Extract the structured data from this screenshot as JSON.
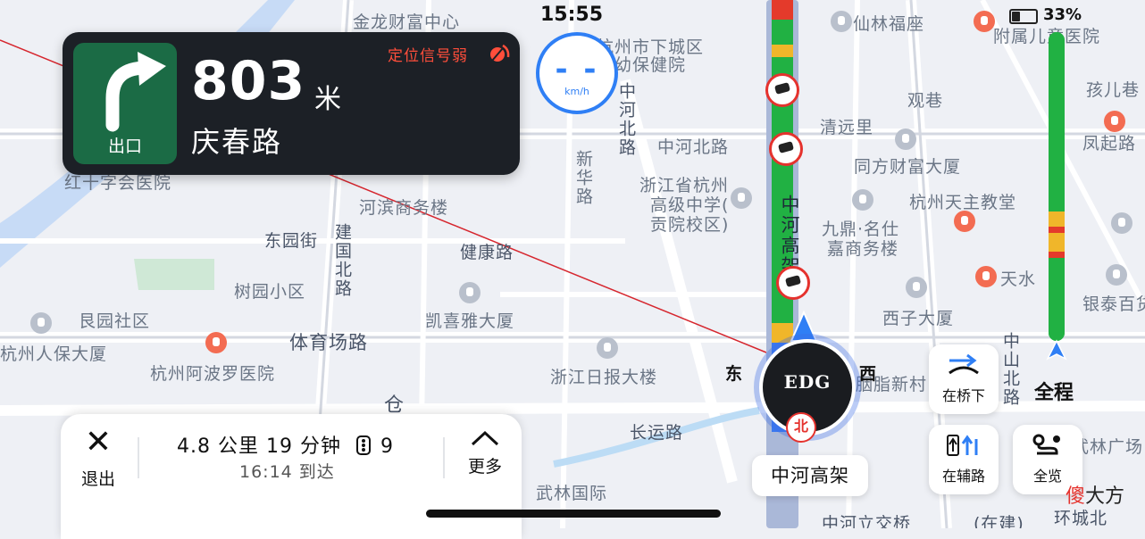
{
  "status": {
    "time": "15:55",
    "battery": "33%"
  },
  "guidance": {
    "distance": "803",
    "unit": "米",
    "road": "庆春路",
    "exit_label": "出口",
    "gps_warning": "定位信号弱"
  },
  "speed": {
    "value": "- -",
    "unit": "km/h"
  },
  "route_progress": {
    "segments": [
      {
        "color": "#21b143",
        "share": 0.58
      },
      {
        "color": "#f0b62a",
        "share": 0.05
      },
      {
        "color": "#e43a2b",
        "share": 0.02
      },
      {
        "color": "#f0b62a",
        "share": 0.06
      },
      {
        "color": "#e43a2b",
        "share": 0.02
      },
      {
        "color": "#21b143",
        "share": 0.27
      }
    ]
  },
  "side_buttons": {
    "bridge": "在桥下",
    "aux_road": "在辅路",
    "overview": "全览",
    "full_route": "全程"
  },
  "bottom": {
    "exit": "退出",
    "summary": "4.8 公里  19 分钟",
    "lights": "9",
    "eta": "16:14 到达",
    "more": "更多"
  },
  "current_road": "中河高架",
  "compass": {
    "east": "东",
    "west": "西",
    "north": "北"
  },
  "car_logo": "EDG",
  "watermark": {
    "part1": "傻",
    "part2": "大方"
  },
  "map_labels": [
    "金龙财富中心",
    "仙林福座",
    "附属儿童医院",
    "杭州市下城区",
    "妇幼保健院",
    "中河北路",
    "清远里",
    "观巷",
    "庆春路",
    "中河北路",
    "新华路",
    "浙江省杭州",
    "高级中学(",
    "贡院校区)",
    "同方财富大厦",
    "杭州天主教堂",
    "九鼎·名仕",
    "嘉商务楼",
    "东园街",
    "健康路",
    "建国北路",
    "树园小区",
    "艮园社区",
    "体育场路",
    "凯喜雅大厦",
    "西子大厦",
    "杭州人保大厦",
    "杭州阿波罗医院",
    "浙江日报大楼",
    "胭脂新村",
    "长运路",
    "中山北路",
    "武林广场",
    "凤起路",
    "银泰百货",
    "天水",
    "武林国际",
    "中河立交桥",
    "(在建)",
    "环城北",
    "河滨商务楼",
    "红十字会医院",
    "孩儿巷",
    "仓"
  ]
}
